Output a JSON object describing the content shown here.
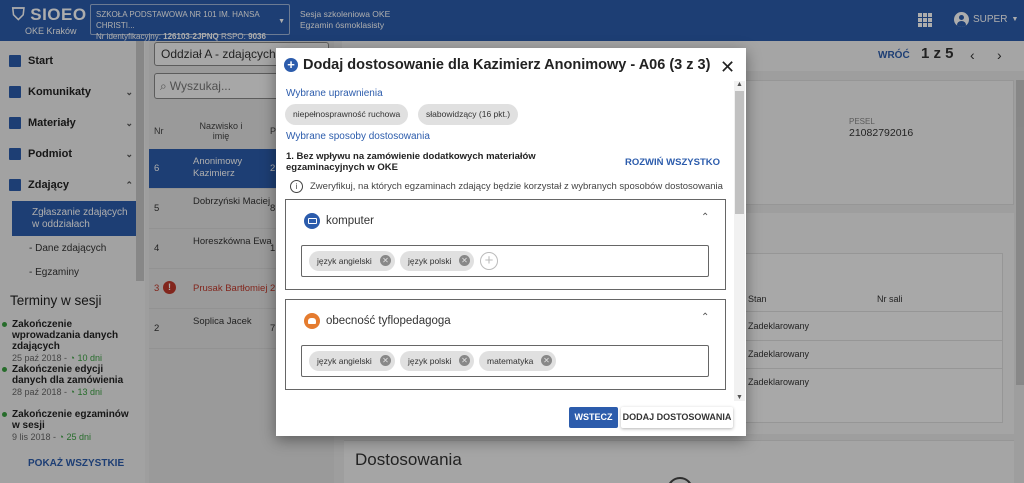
{
  "header": {
    "logo_title": "SIOEO",
    "logo_subtitle": "OKE Kraków",
    "school_line1": "SZKOŁA PODSTAWOWA NR 101 IM. HANSA CHRISTI...",
    "school_id_label": "Nr identyfikacyjny:",
    "school_id": "126103-2JPNQ",
    "rspo_label": "RSPO:",
    "rspo": "9036",
    "session_line1": "Sesja szkoleniowa OKE",
    "session_line2": "Egzamin ósmoklasisty",
    "user_name": "SUPER"
  },
  "sidebar": {
    "items": [
      {
        "label": "Start"
      },
      {
        "label": "Komunikaty"
      },
      {
        "label": "Materiały"
      },
      {
        "label": "Podmiot"
      },
      {
        "label": "Zdający"
      }
    ],
    "sub_active": "Zgłaszanie zdających w oddziałach",
    "sub_items": [
      "- Dane zdających",
      "- Egzaminy"
    ],
    "terms_title": "Terminy w sesji",
    "terms": [
      {
        "title": "Zakończenie wprowadzania danych zdających",
        "date": "25 paź 2018",
        "days": "10 dni"
      },
      {
        "title": "Zakończenie edycji danych dla zamówienia",
        "date": "28 paź 2018",
        "days": "13 dni"
      },
      {
        "title": "Zakończenie egzaminów w sesji",
        "date": "9 lis 2018",
        "days": "25 dni"
      }
    ],
    "show_all": "POKAŻ WSZYSTKIE"
  },
  "list": {
    "filter_value": "Oddział A - zdających: 5",
    "search_placeholder": "Wyszukaj...",
    "col_nr": "Nr",
    "col_name": "Nazwisko i imię",
    "col_p": "P",
    "rows": [
      {
        "nr": "6",
        "name": "Anonimowy Kazimierz",
        "p": "2"
      },
      {
        "nr": "5",
        "name": "Dobrzyński Maciej",
        "p": "8"
      },
      {
        "nr": "4",
        "name": "Horeszkówna Ewa",
        "p": "1"
      },
      {
        "nr": "3",
        "name": "Prusak Bartłomiej",
        "p": "2"
      },
      {
        "nr": "2",
        "name": "Soplica Jacek",
        "p": "7"
      }
    ]
  },
  "detail": {
    "back": "WRÓĆ",
    "pager": "1 z 5",
    "pesel_label": "PESEL",
    "pesel": "21082792016",
    "col_status": "Stan",
    "col_room": "Nr sali",
    "statuses": [
      "Zadeklarowany",
      "Zadeklarowany",
      "Zadeklarowany"
    ],
    "section_title": "Dostosowania"
  },
  "modal": {
    "title": "Dodaj dostosowanie dla Kazimierz Anonimowy - A06 (3 z 3)",
    "selected_rights_label": "Wybrane uprawnienia",
    "rights": [
      "niepełnosprawność ruchowa",
      "słabowidzący (16 pkt.)"
    ],
    "selected_methods_label": "Wybrane sposoby dostosowania",
    "question": "1. Bez wpływu na zamówienie dodatkowych materiałów egzaminacyjnych w OKE",
    "expand_all": "ROZWIŃ WSZYSTKO",
    "info": "Zweryfikuj, na których egzaminach zdający będzie korzystał z wybranych sposobów dostosowania",
    "panels": [
      {
        "title": "komputer",
        "chips": [
          "język angielski",
          "język polski"
        ]
      },
      {
        "title": "obecność tyflopedagoga",
        "chips": [
          "język angielski",
          "język polski",
          "matematyka"
        ]
      }
    ],
    "btn_back": "WSTECZ",
    "btn_add": "DODAJ DOSTOSOWANIA"
  }
}
